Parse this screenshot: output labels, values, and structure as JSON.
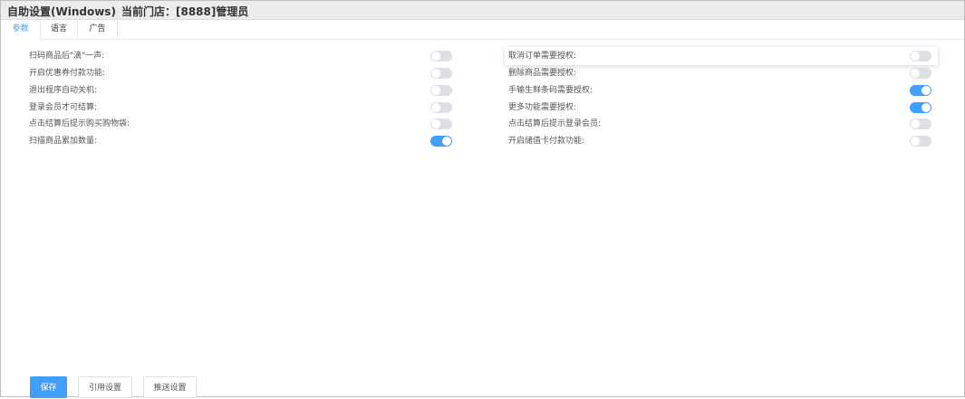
{
  "header": {
    "title": "自助设置(Windows)",
    "store": "当前门店：[8888]管理员"
  },
  "tabs": [
    {
      "label": "参数",
      "active": true
    },
    {
      "label": "语言",
      "active": false
    },
    {
      "label": "广告",
      "active": false
    }
  ],
  "colors": {
    "accent": "#409eff",
    "switch_off": "#dcdfe6"
  },
  "settings_left": [
    {
      "label": "扫码商品后\"滴\"一声:",
      "on": false
    },
    {
      "label": "开启优惠券付款功能:",
      "on": false
    },
    {
      "label": "退出程序自动关机:",
      "on": false
    },
    {
      "label": "登录会员才可结算:",
      "on": false
    },
    {
      "label": "点击结算后提示购买购物袋:",
      "on": false
    },
    {
      "label": "扫描商品累加数量:",
      "on": true
    }
  ],
  "settings_right": [
    {
      "label": "取消订单需要授权:",
      "on": false
    },
    {
      "label": "删除商品需要授权:",
      "on": false
    },
    {
      "label": "手输生鲜条码需要授权:",
      "on": true
    },
    {
      "label": "更多功能需要授权:",
      "on": true
    },
    {
      "label": "点击结算后提示登录会员:",
      "on": false
    },
    {
      "label": "开启储值卡付款功能:",
      "on": false
    }
  ],
  "buttons": {
    "save": "保存",
    "reference": "引用设置",
    "push": "推送设置"
  }
}
